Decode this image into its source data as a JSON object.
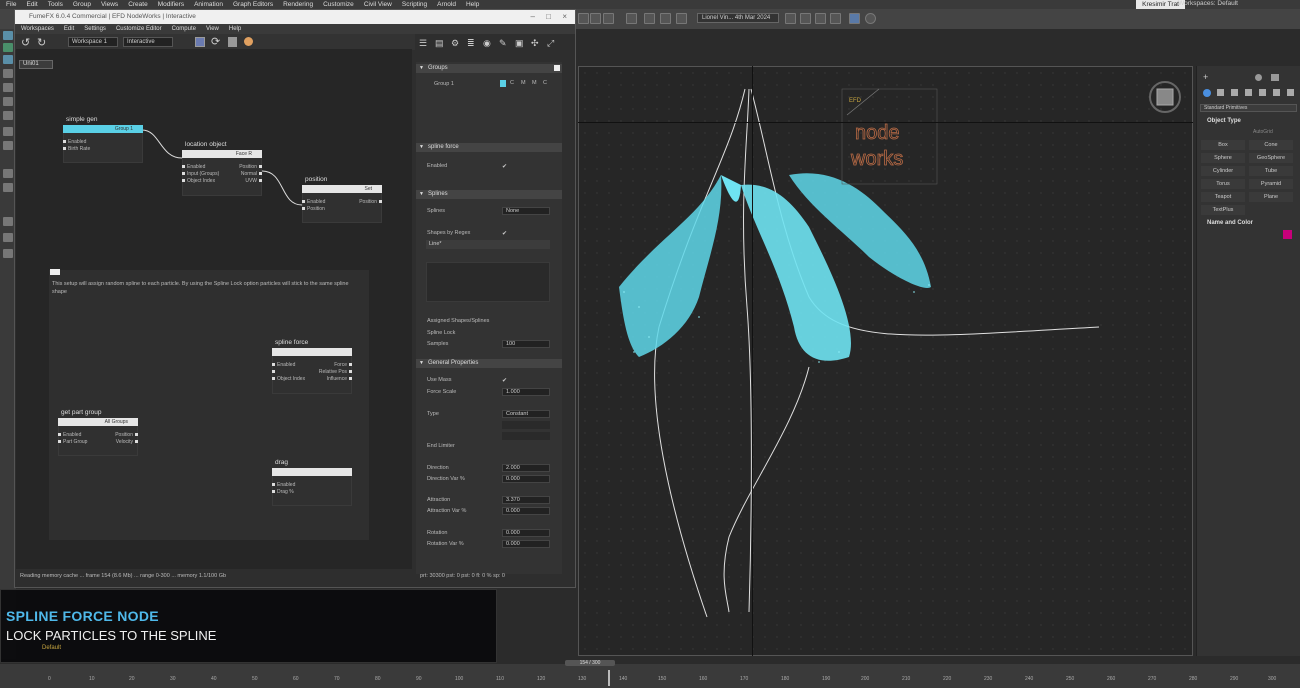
{
  "menubar": {
    "items": [
      "File",
      "Edit",
      "Tools",
      "Group",
      "Views",
      "Create",
      "Modifiers",
      "Animation",
      "Graph Editors",
      "Rendering",
      "Customize",
      "Civil View",
      "Scripting",
      "Arnold",
      "Help"
    ],
    "user": "Kresimir Trat",
    "workspace": "Workspaces: Default"
  },
  "maintoolbar": {
    "date_field": "Lionel Vin... 4th Mar 2024"
  },
  "fume": {
    "title": "FumeFX 6.0.4 Commercial | EFD NodeWorks | Interactive",
    "menu": [
      "Workspaces",
      "Edit",
      "Settings",
      "Customize Editor",
      "Compute",
      "View",
      "Help"
    ],
    "workspace_select": "Workspace 1",
    "mode_select": "Interactive",
    "tab": "Uni01",
    "nodes": {
      "simple_gen": {
        "title": "simple gen",
        "head": "Group 1",
        "ports": [
          "Enabled",
          "Birth Rate"
        ]
      },
      "location_object": {
        "title": "location object",
        "head": "Face R",
        "ports": [
          "Enabled",
          "Input (Groups)",
          "Object Index"
        ],
        "outs": [
          "Position",
          "Normal",
          "UVW"
        ]
      },
      "position": {
        "title": "position",
        "head": "Set",
        "ports": [
          "Enabled",
          "Position"
        ],
        "outs": [
          "Position"
        ]
      },
      "spline_force": {
        "title": "spline force",
        "head": "",
        "ports": [
          "Enabled",
          "",
          "Object Index"
        ],
        "outs": [
          "Force",
          "Relative Pos",
          "Influence"
        ]
      },
      "get_part_group": {
        "title": "get part group",
        "head": "All Groups",
        "ports": [
          "Enabled",
          "Part Group"
        ],
        "outs": [
          "Position",
          "Velocity"
        ]
      },
      "drag": {
        "title": "drag",
        "head": "",
        "ports": [
          "Enabled",
          "Drag %"
        ]
      }
    },
    "note": "This setup will assign random spline to each particle. By using the Spline Lock option particles will stick to the same spline shape",
    "status_left": "Reading memory cache ... frame 154 (8.6 Mb) ... range 0-300 ... memory 1.1/100 Gb",
    "status_right": "prt: 30300 pst: 0 pst: 0 fl: 0 % sp: 0"
  },
  "props": {
    "groups": {
      "header": "Groups",
      "item": "Group 1",
      "flags": [
        "C",
        "M",
        "M",
        "C"
      ]
    },
    "spline_force": {
      "header": "spline force",
      "enabled_label": "Enabled",
      "enabled": "✔"
    },
    "splines": {
      "header": "Splines",
      "splines_label": "Splines",
      "splines_value": "None",
      "shapes_label": "Shapes by Regex",
      "shapes_check": "✔",
      "regex_value": "Line*",
      "assigned_label": "Assigned Shapes/Splines",
      "lock_label": "Spline Lock",
      "samples_label": "Samples",
      "samples_value": "100"
    },
    "general": {
      "header": "General Properties",
      "usemass_label": "Use Mass",
      "usemass_check": "✔",
      "forcescale_label": "Force Scale",
      "forcescale_value": "1.000",
      "type_label": "Type",
      "type_value": "Constant",
      "endlimiter_label": "End Limiter",
      "direction_label": "Direction",
      "direction_value": "2.000",
      "dirvar_label": "Direction Var %",
      "dirvar_value": "0.000",
      "attraction_label": "Attraction",
      "attraction_value": "3.370",
      "attrvar_label": "Attraction Var %",
      "attrvar_value": "0.000",
      "rotation_label": "Rotation",
      "rotation_value": "0.000",
      "rotvar_label": "Rotation Var %",
      "rotvar_value": "0.000"
    }
  },
  "cmdpanel": {
    "dropdown": "Standard Primitives",
    "object_type": "Object Type",
    "autogrid": "AutoGrid",
    "buttons": [
      "Box",
      "Cone",
      "Sphere",
      "GeoSphere",
      "Cylinder",
      "Tube",
      "Torus",
      "Pyramid",
      "Teapot",
      "Plane",
      "TextPlus"
    ],
    "name_color": "Name and Color"
  },
  "viewport": {
    "logo_line1": "node",
    "logo_line2": "works",
    "logo_tag": "EFD",
    "particle_color": "#6fe3f2"
  },
  "caption": {
    "title": "SPLINE FORCE NODE",
    "subtitle": "LOCK PARTICLES TO THE SPLINE",
    "default": "Default"
  },
  "timeline": {
    "frame": "154 / 300",
    "ticks": [
      "0",
      "10",
      "20",
      "30",
      "40",
      "50",
      "60",
      "70",
      "80",
      "90",
      "100",
      "110",
      "120",
      "130",
      "140",
      "150",
      "160",
      "170",
      "180",
      "190",
      "200",
      "210",
      "220",
      "230",
      "240",
      "250",
      "260",
      "270",
      "280",
      "290",
      "300"
    ]
  }
}
